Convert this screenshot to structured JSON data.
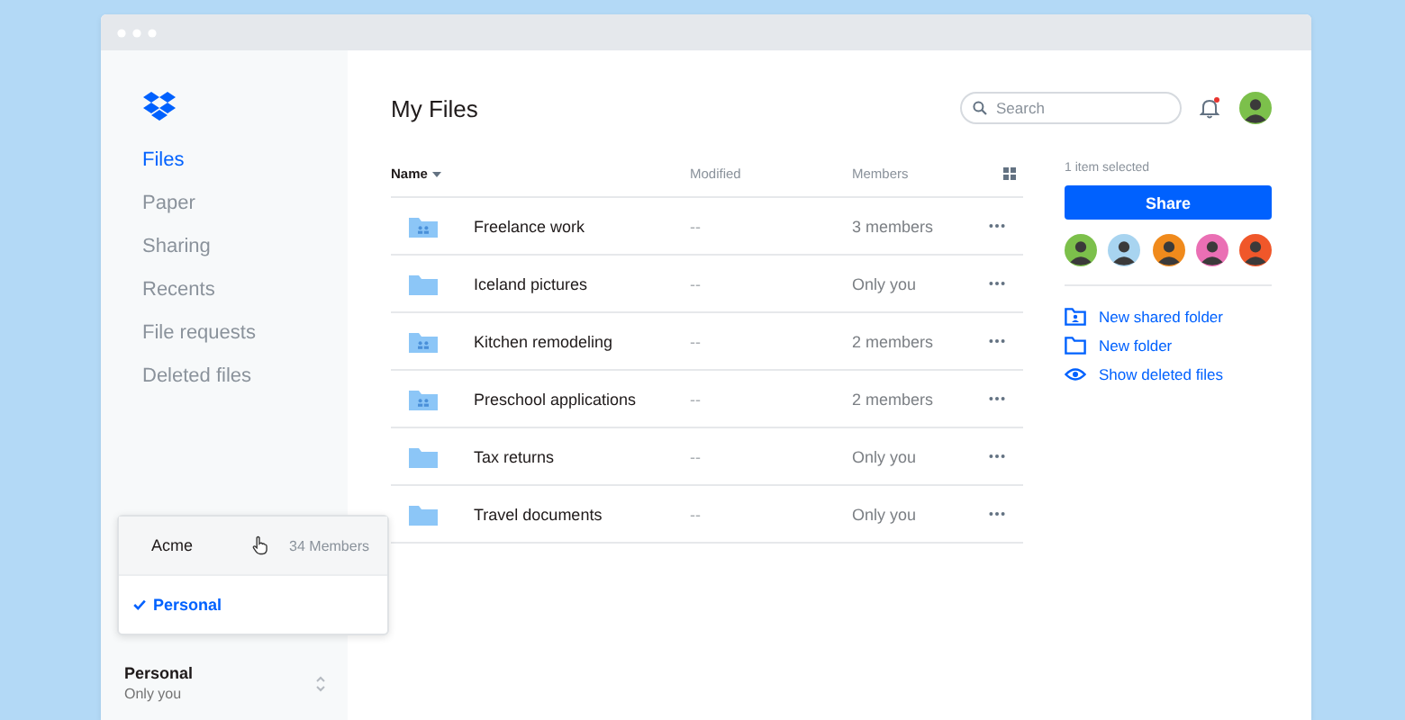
{
  "sidebar": {
    "items": [
      {
        "label": "Files",
        "selected": true
      },
      {
        "label": "Paper",
        "selected": false
      },
      {
        "label": "Sharing",
        "selected": false
      },
      {
        "label": "Recents",
        "selected": false
      },
      {
        "label": "File requests",
        "selected": false
      },
      {
        "label": "Deleted files",
        "selected": false
      }
    ],
    "account_menu": [
      {
        "name": "Acme",
        "members": "34 Members",
        "selected": false,
        "hovered": true
      },
      {
        "name": "Personal",
        "selected": true,
        "hovered": false
      }
    ],
    "account": {
      "name": "Personal",
      "detail": "Only you"
    }
  },
  "header": {
    "title": "My Files",
    "search": {
      "placeholder": "Search"
    },
    "unread_notifications": true
  },
  "table": {
    "columns": [
      {
        "label": "Name",
        "sorted": true
      },
      {
        "label": "Modified",
        "sorted": false
      },
      {
        "label": "Members",
        "sorted": false
      }
    ],
    "rows": [
      {
        "name": "Freelance work",
        "kind": "shared",
        "modified": "--",
        "members": "3 members"
      },
      {
        "name": "Iceland pictures",
        "kind": "plain",
        "modified": "--",
        "members": "Only you"
      },
      {
        "name": "Kitchen remodeling",
        "kind": "shared",
        "modified": "--",
        "members": "2 members"
      },
      {
        "name": "Preschool applications",
        "kind": "shared",
        "modified": "--",
        "members": "2 members"
      },
      {
        "name": "Tax returns",
        "kind": "plain",
        "modified": "--",
        "members": "Only you"
      },
      {
        "name": "Travel documents",
        "kind": "plain",
        "modified": "--",
        "members": "Only you"
      }
    ]
  },
  "details": {
    "selection": "1 item selected",
    "share_button": "Share",
    "members": [
      {
        "color": "#7cc04b"
      },
      {
        "color": "#a8d4f0"
      },
      {
        "color": "#f08a1c"
      },
      {
        "color": "#ea6fb4"
      },
      {
        "color": "#f0572a"
      }
    ],
    "actions": [
      {
        "label": "New shared folder",
        "kind": "shared-folder"
      },
      {
        "label": "New folder",
        "kind": "folder"
      },
      {
        "label": "Show deleted files",
        "kind": "eye"
      }
    ]
  }
}
